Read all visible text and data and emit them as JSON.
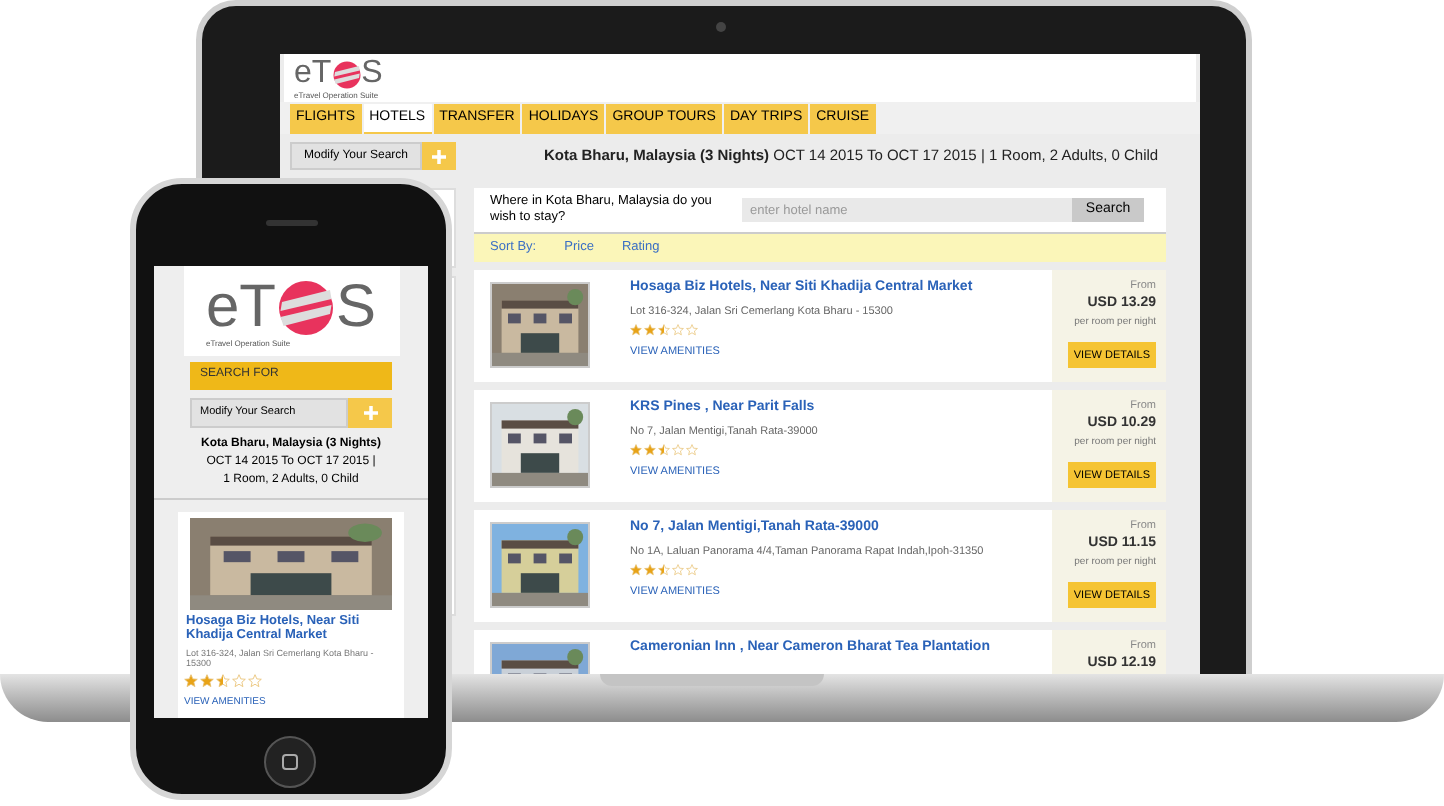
{
  "laptop": {
    "logo": {
      "left": "eT",
      "right": "S",
      "tagline": "eTravel Operation Suite"
    },
    "nav": [
      {
        "label": "FLIGHTS",
        "selected": false
      },
      {
        "label": "HOTELS",
        "selected": true
      },
      {
        "label": "TRANSFER",
        "selected": false
      },
      {
        "label": "HOLIDAYS",
        "selected": false
      },
      {
        "label": "GROUP TOURS",
        "selected": false
      },
      {
        "label": "DAY TRIPS",
        "selected": false
      },
      {
        "label": "CRUISE",
        "selected": false
      }
    ],
    "modify_button": "Modify Your Search",
    "summary": {
      "place": "Kota Bharu, Malaysia (3 Nights)",
      "details": "OCT 14 2015 To OCT 17 2015  |  1 Room, 2 Adults, 0 Child"
    },
    "search": {
      "prompt": "Where in Kota Bharu, Malaysia do you wish to stay?",
      "placeholder": "enter hotel name",
      "button": "Search"
    },
    "sort": {
      "label": "Sort By:",
      "options": [
        "Price",
        "Rating"
      ]
    },
    "hotels": [
      {
        "name": "Hosaga Biz Hotels, Near Siti Khadija Central Market",
        "address": "Lot 316-324, Jalan Sri Cemerlang Kota Bharu - 15300",
        "stars": 2.5,
        "amenities": "VIEW AMENITIES",
        "from": "From",
        "price": "USD 13.29",
        "unit": "per room per night",
        "button": "VIEW DETAILS"
      },
      {
        "name": "KRS Pines , Near Parit Falls",
        "address": "No 7, Jalan Mentigi,Tanah Rata-39000",
        "stars": 2.5,
        "amenities": "VIEW AMENITIES",
        "from": "From",
        "price": "USD 10.29",
        "unit": "per room per night",
        "button": "VIEW DETAILS"
      },
      {
        "name": "No 7, Jalan Mentigi,Tanah Rata-39000",
        "address": "No 1A, Laluan Panorama 4/4,Taman Panorama Rapat Indah,Ipoh-31350",
        "stars": 2.5,
        "amenities": "VIEW AMENITIES",
        "from": "From",
        "price": "USD 11.15",
        "unit": "per room per night",
        "button": "VIEW DETAILS"
      },
      {
        "name": "Cameronian Inn , Near Cameron Bharat Tea Plantation",
        "from": "From",
        "price": "USD 12.19"
      }
    ]
  },
  "phone": {
    "logo": {
      "left": "eT",
      "right": "S",
      "tagline": "eTravel Operation Suite"
    },
    "search_for": "SEARCH FOR",
    "modify_button": "Modify Your Search",
    "summary": {
      "place": "Kota Bharu, Malaysia (3 Nights)",
      "dates": "OCT 14 2015 To OCT 17 2015  |",
      "guests": "1 Room, 2 Adults, 0 Child"
    },
    "hotel": {
      "name": "Hosaga Biz Hotels, Near Siti Khadija Central Market",
      "address": "Lot 316-324, Jalan Sri Cemerlang Kota Bharu - 15300",
      "stars": 2.5,
      "amenities": "VIEW AMENITIES"
    }
  }
}
